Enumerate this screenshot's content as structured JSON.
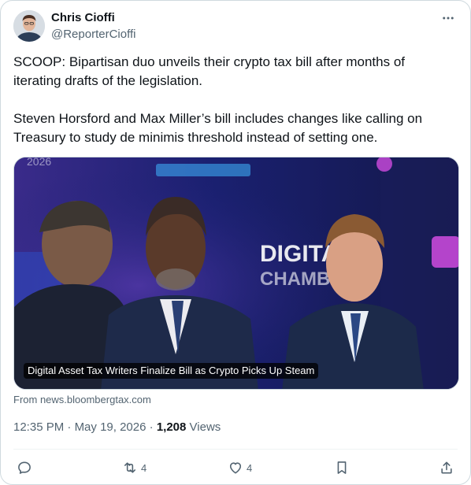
{
  "author": {
    "name": "Chris Cioffi",
    "handle": "@ReporterCioffi"
  },
  "tweet": {
    "paragraph1": "SCOOP: Bipartisan duo unveils their crypto tax bill after months of iterating drafts of the legislation.",
    "paragraph2": "Steven Horsford and Max Miller’s bill includes changes like calling on Treasury to study de minimis threshold instead of setting one."
  },
  "link_card": {
    "caption": "Digital Asset Tax Writers Finalize Bill as Crypto Picks Up Steam",
    "source": "From news.bloombergtax.com",
    "backdrop_text": [
      "DIGITA",
      "CHAMBE",
      "2026"
    ]
  },
  "meta": {
    "time": "12:35 PM",
    "separator": "·",
    "date": "May 19, 2026",
    "views_count": "1,208",
    "views_label": "Views"
  },
  "actions": {
    "reply_count": "",
    "retweet_count": "4",
    "like_count": "4"
  },
  "colors": {
    "text": "#0f1419",
    "secondary": "#536471",
    "border": "#cfd9de"
  }
}
